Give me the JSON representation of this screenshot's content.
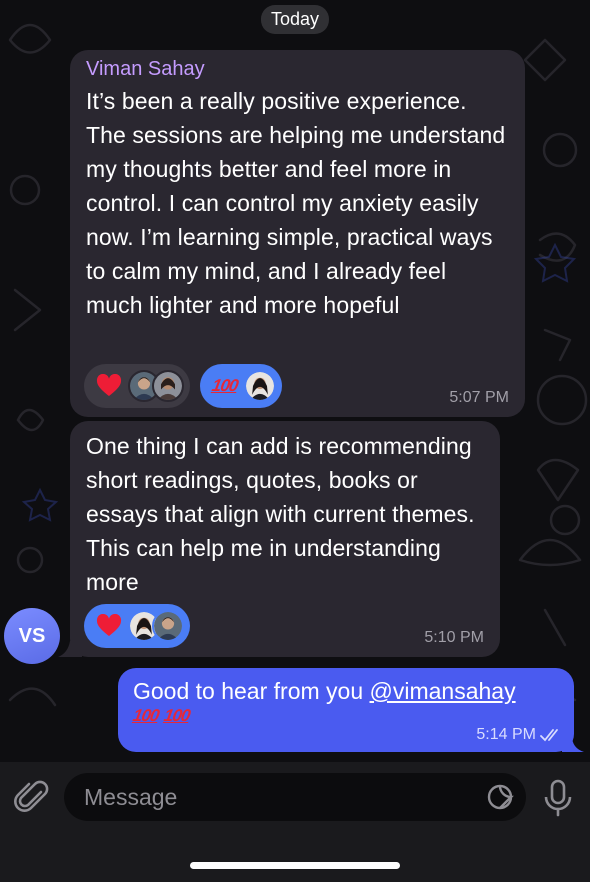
{
  "date_separator": "Today",
  "messages": [
    {
      "sender": "Viman Sahay",
      "text": "It’s been a really positive experience. The sessions are helping me understand my thoughts better and feel more in control. I can control my anxiety easily now. I’m learning simple, practical ways to calm my mind, and I already feel much lighter and more hopeful",
      "time": "5:07 PM",
      "reactions": [
        {
          "emoji": "heart-icon",
          "style": "dark"
        },
        {
          "emoji": "hundred-icon",
          "style": "blue"
        }
      ]
    },
    {
      "text": "One thing I can add is recommending short readings, quotes, books or essays that align with current themes. This can help me in understanding more",
      "time": "5:10 PM",
      "reactions": [
        {
          "emoji": "heart-icon",
          "style": "blue"
        }
      ]
    }
  ],
  "sender_avatar_initials": "VS",
  "outgoing": {
    "text_prefix": "Good to hear from you ",
    "mention": "@vimansahay",
    "emoji": [
      "💯",
      "💯"
    ],
    "time": "5:14 PM"
  },
  "composer": {
    "placeholder": "Message"
  },
  "colors": {
    "incoming_bubble": "#2a2730",
    "outgoing_bubble": "#4a5bf0",
    "sender_name": "#c59cff",
    "reaction_blue": "#4a7df5"
  }
}
